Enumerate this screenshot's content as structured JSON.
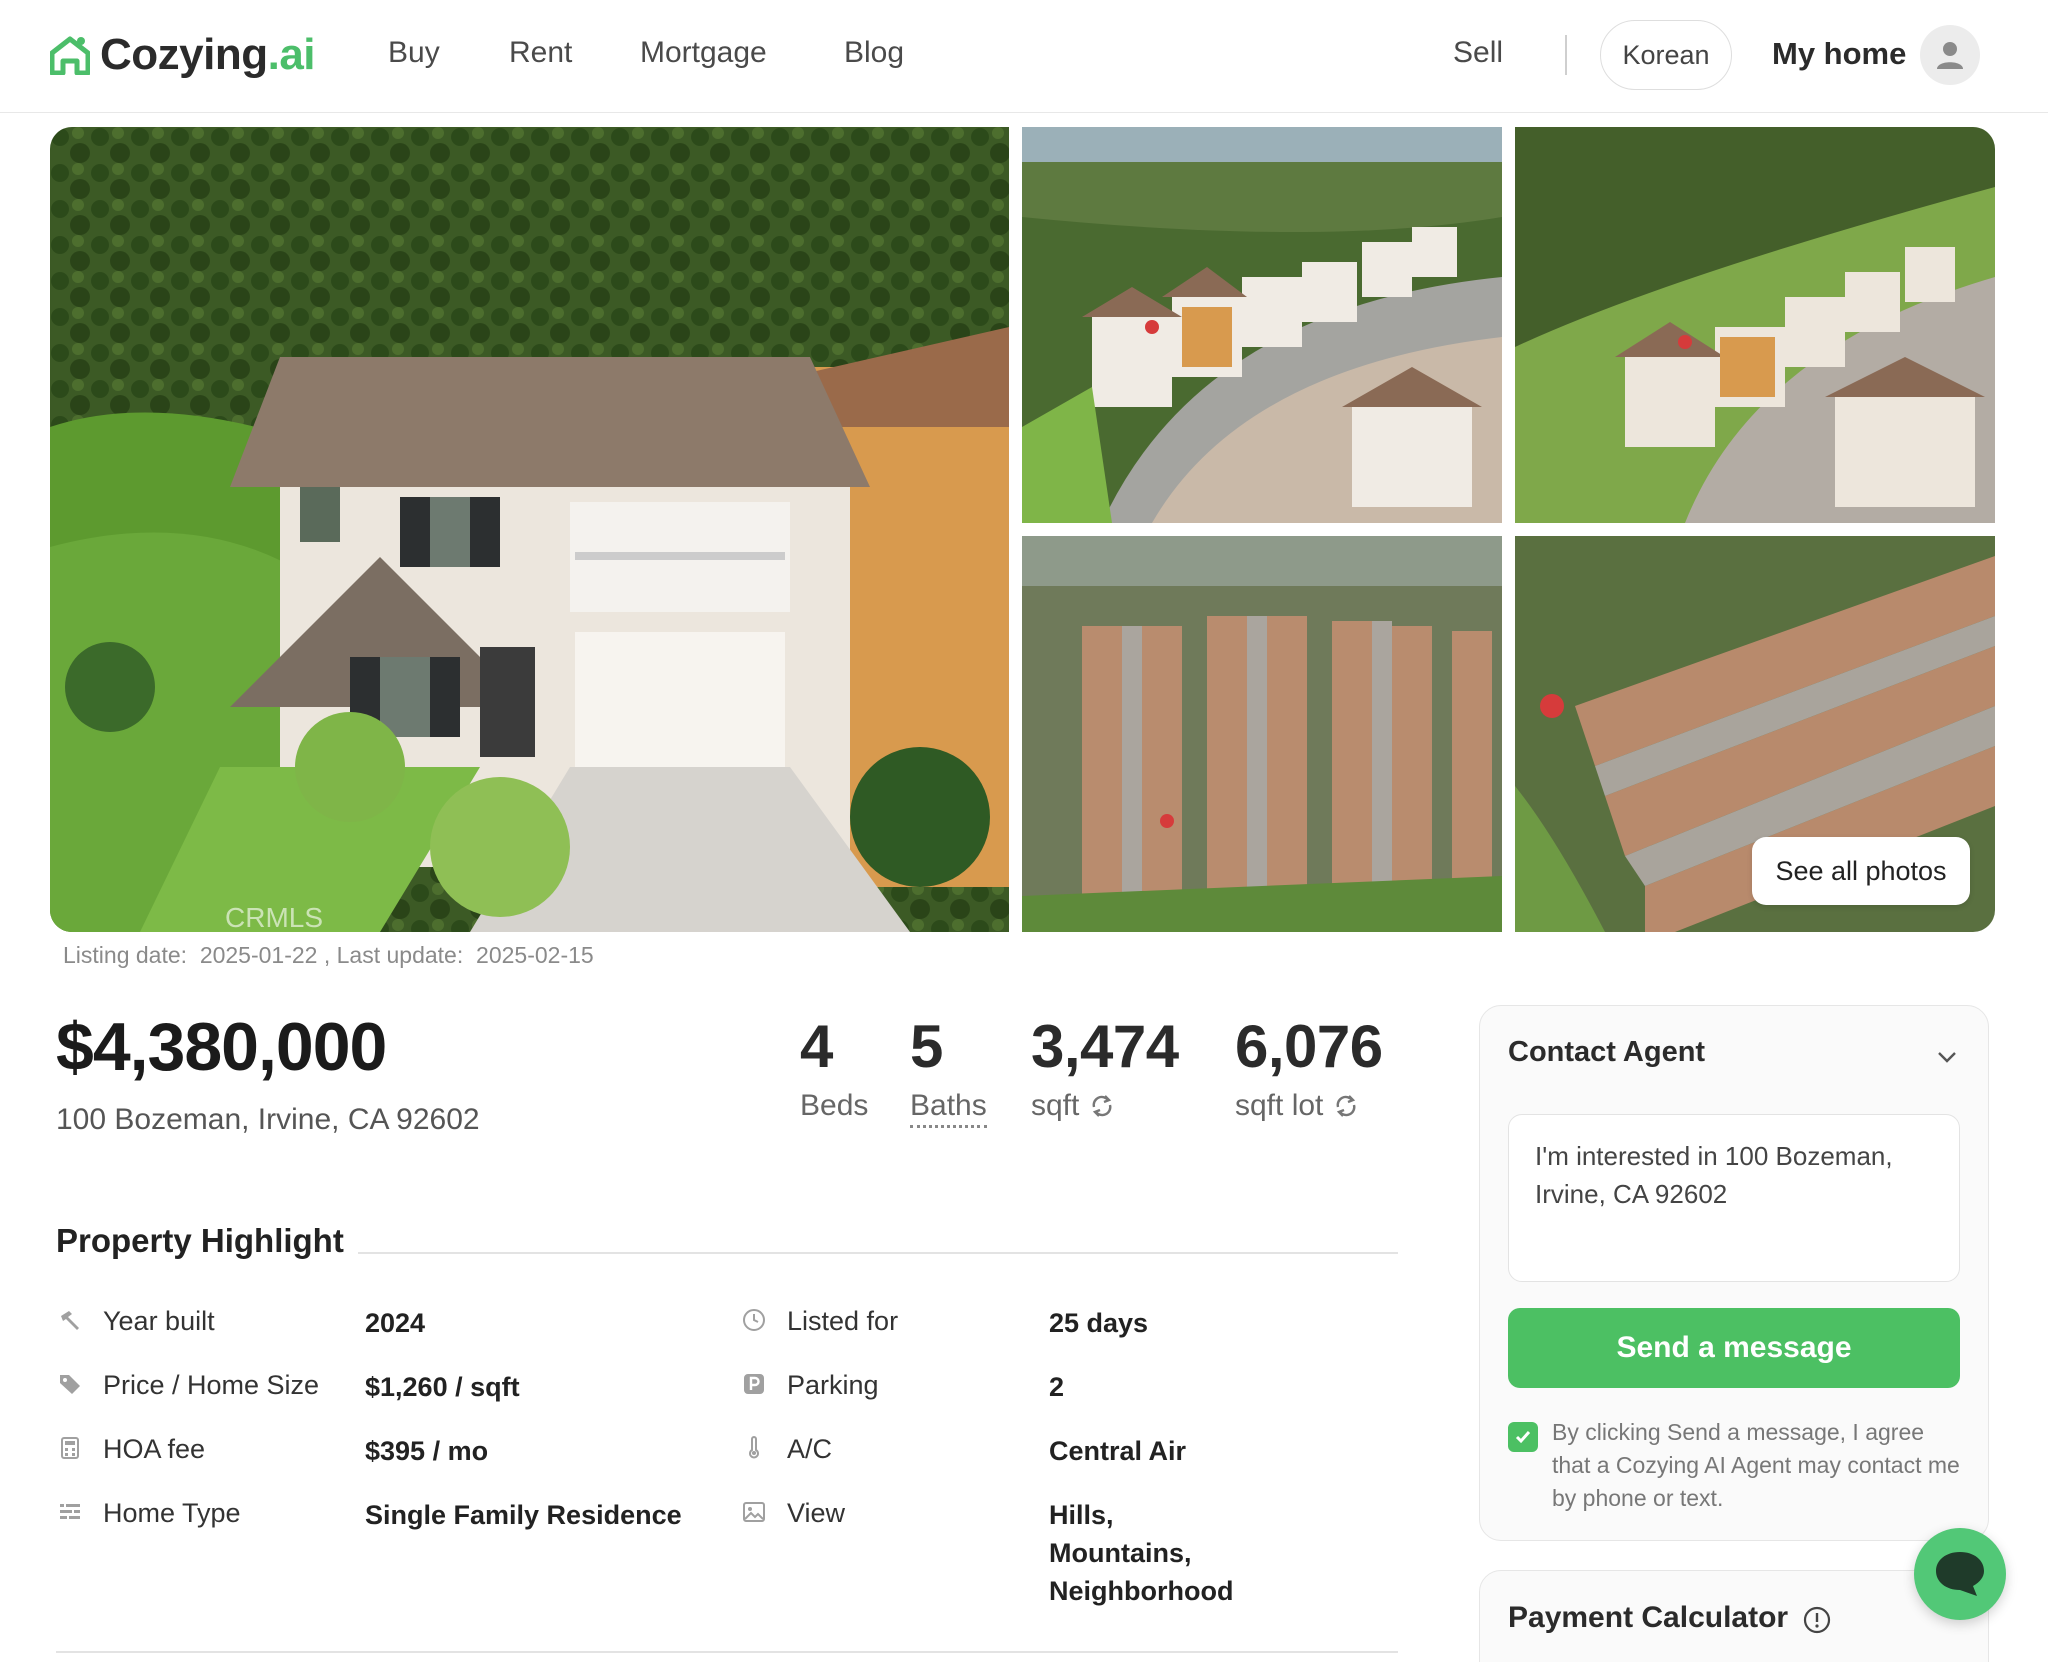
{
  "brand": {
    "name_main": "Cozying",
    "name_suffix": ".ai",
    "accent": "#4cbe6a"
  },
  "nav": {
    "links": [
      "Buy",
      "Rent",
      "Mortgage",
      "Blog"
    ],
    "sell": "Sell",
    "language": "Korean",
    "my_home": "My home"
  },
  "gallery": {
    "see_all": "See all photos",
    "watermark": "CRMLS"
  },
  "listing": {
    "listing_date_label": "Listing date:",
    "listing_date": "2025-01-22",
    "last_update_label": ", Last update:",
    "last_update": "2025-02-15",
    "price": "$4,380,000",
    "address": "100 Bozeman, Irvine, CA 92602"
  },
  "stats": [
    {
      "value": "4",
      "label": "Beds"
    },
    {
      "value": "5",
      "label": "Baths"
    },
    {
      "value": "3,474",
      "label": "sqft"
    },
    {
      "value": "6,076",
      "label": "sqft lot"
    }
  ],
  "highlight": {
    "title": "Property Highlight",
    "left": [
      {
        "icon": "hammer-icon",
        "label": "Year built",
        "value": "2024"
      },
      {
        "icon": "tag-icon",
        "label": "Price / Home Size",
        "value": "$1,260 / sqft"
      },
      {
        "icon": "calculator-icon",
        "label": "HOA fee",
        "value": "$395 / mo"
      },
      {
        "icon": "building-icon",
        "label": "Home Type",
        "value": "Single Family Residence"
      }
    ],
    "right": [
      {
        "icon": "clock-icon",
        "label": "Listed for",
        "value": "25 days"
      },
      {
        "icon": "parking-icon",
        "label": "Parking",
        "value": "2"
      },
      {
        "icon": "thermometer-icon",
        "label": "A/C",
        "value": "Central Air"
      },
      {
        "icon": "image-icon",
        "label": "View",
        "value_lines": [
          "Hills,",
          "Mountains,",
          "Neighborhood"
        ]
      }
    ]
  },
  "contact": {
    "title": "Contact Agent",
    "message": "I'm interested in 100 Bozeman, Irvine, CA 92602",
    "send_label": "Send a message",
    "consent": "By clicking Send a message, I agree that a Cozying AI Agent may contact me by phone or text.",
    "consent_checked": true
  },
  "payment": {
    "title": "Payment Calculator"
  }
}
